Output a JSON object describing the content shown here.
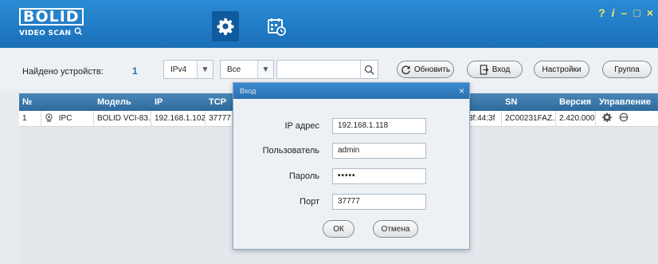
{
  "header": {
    "logo_top": "BOLID",
    "logo_bottom": "VIDEO SCAN",
    "controls": [
      "?",
      "i",
      "–",
      "□",
      "×"
    ]
  },
  "toolbar": {
    "found_label": "Найдено устройств:",
    "found_count": "1",
    "ip_version": "IPv4",
    "filter": "Все",
    "search_value": "",
    "refresh_label": "Обновить",
    "login_label": "Вход",
    "settings_label": "Настройки",
    "group_label": "Группа"
  },
  "table": {
    "headers": [
      "№",
      "",
      "Модель",
      "IP",
      "TCP",
      "",
      "SN",
      "Версия",
      "Управление"
    ],
    "rows": [
      {
        "num": "1",
        "type": "IPC",
        "model": "BOLID VCI-83...",
        "ip": "192.168.1.102",
        "tcp": "37777",
        "mac": "3f:44:3f",
        "sn": "2C00231FAZ...",
        "version": "2.420.000..."
      }
    ]
  },
  "dialog": {
    "title": "Вход",
    "ip_label": "IP адрес",
    "ip_value": "192.168.1.118",
    "user_label": "Пользователь",
    "user_value": "admin",
    "password_label": "Пароль",
    "password_value": "•••••",
    "port_label": "Порт",
    "port_value": "37777",
    "ok_label": "ОК",
    "cancel_label": "Отмена"
  },
  "colors": {
    "header_blue": "#1a6fb8",
    "accent_yellow": "#ffe65a"
  }
}
